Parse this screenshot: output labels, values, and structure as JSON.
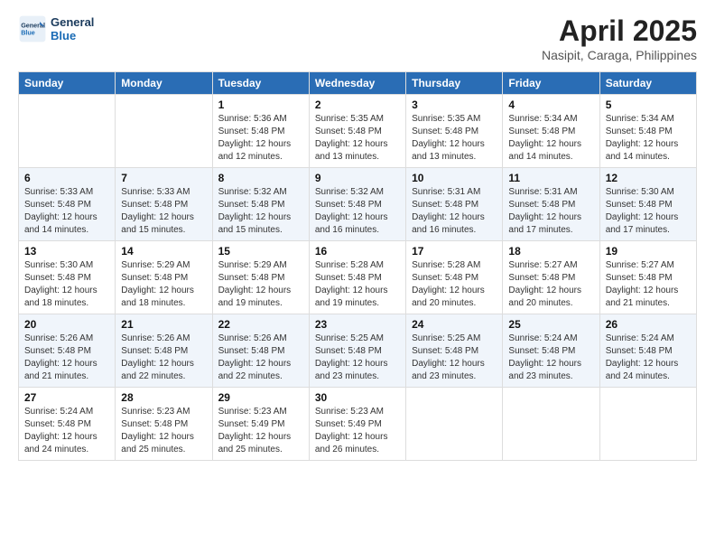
{
  "header": {
    "logo_line1": "General",
    "logo_line2": "Blue",
    "month_title": "April 2025",
    "location": "Nasipit, Caraga, Philippines"
  },
  "weekdays": [
    "Sunday",
    "Monday",
    "Tuesday",
    "Wednesday",
    "Thursday",
    "Friday",
    "Saturday"
  ],
  "weeks": [
    [
      {
        "day": "",
        "info": ""
      },
      {
        "day": "",
        "info": ""
      },
      {
        "day": "1",
        "info": "Sunrise: 5:36 AM\nSunset: 5:48 PM\nDaylight: 12 hours\nand 12 minutes."
      },
      {
        "day": "2",
        "info": "Sunrise: 5:35 AM\nSunset: 5:48 PM\nDaylight: 12 hours\nand 13 minutes."
      },
      {
        "day": "3",
        "info": "Sunrise: 5:35 AM\nSunset: 5:48 PM\nDaylight: 12 hours\nand 13 minutes."
      },
      {
        "day": "4",
        "info": "Sunrise: 5:34 AM\nSunset: 5:48 PM\nDaylight: 12 hours\nand 14 minutes."
      },
      {
        "day": "5",
        "info": "Sunrise: 5:34 AM\nSunset: 5:48 PM\nDaylight: 12 hours\nand 14 minutes."
      }
    ],
    [
      {
        "day": "6",
        "info": "Sunrise: 5:33 AM\nSunset: 5:48 PM\nDaylight: 12 hours\nand 14 minutes."
      },
      {
        "day": "7",
        "info": "Sunrise: 5:33 AM\nSunset: 5:48 PM\nDaylight: 12 hours\nand 15 minutes."
      },
      {
        "day": "8",
        "info": "Sunrise: 5:32 AM\nSunset: 5:48 PM\nDaylight: 12 hours\nand 15 minutes."
      },
      {
        "day": "9",
        "info": "Sunrise: 5:32 AM\nSunset: 5:48 PM\nDaylight: 12 hours\nand 16 minutes."
      },
      {
        "day": "10",
        "info": "Sunrise: 5:31 AM\nSunset: 5:48 PM\nDaylight: 12 hours\nand 16 minutes."
      },
      {
        "day": "11",
        "info": "Sunrise: 5:31 AM\nSunset: 5:48 PM\nDaylight: 12 hours\nand 17 minutes."
      },
      {
        "day": "12",
        "info": "Sunrise: 5:30 AM\nSunset: 5:48 PM\nDaylight: 12 hours\nand 17 minutes."
      }
    ],
    [
      {
        "day": "13",
        "info": "Sunrise: 5:30 AM\nSunset: 5:48 PM\nDaylight: 12 hours\nand 18 minutes."
      },
      {
        "day": "14",
        "info": "Sunrise: 5:29 AM\nSunset: 5:48 PM\nDaylight: 12 hours\nand 18 minutes."
      },
      {
        "day": "15",
        "info": "Sunrise: 5:29 AM\nSunset: 5:48 PM\nDaylight: 12 hours\nand 19 minutes."
      },
      {
        "day": "16",
        "info": "Sunrise: 5:28 AM\nSunset: 5:48 PM\nDaylight: 12 hours\nand 19 minutes."
      },
      {
        "day": "17",
        "info": "Sunrise: 5:28 AM\nSunset: 5:48 PM\nDaylight: 12 hours\nand 20 minutes."
      },
      {
        "day": "18",
        "info": "Sunrise: 5:27 AM\nSunset: 5:48 PM\nDaylight: 12 hours\nand 20 minutes."
      },
      {
        "day": "19",
        "info": "Sunrise: 5:27 AM\nSunset: 5:48 PM\nDaylight: 12 hours\nand 21 minutes."
      }
    ],
    [
      {
        "day": "20",
        "info": "Sunrise: 5:26 AM\nSunset: 5:48 PM\nDaylight: 12 hours\nand 21 minutes."
      },
      {
        "day": "21",
        "info": "Sunrise: 5:26 AM\nSunset: 5:48 PM\nDaylight: 12 hours\nand 22 minutes."
      },
      {
        "day": "22",
        "info": "Sunrise: 5:26 AM\nSunset: 5:48 PM\nDaylight: 12 hours\nand 22 minutes."
      },
      {
        "day": "23",
        "info": "Sunrise: 5:25 AM\nSunset: 5:48 PM\nDaylight: 12 hours\nand 23 minutes."
      },
      {
        "day": "24",
        "info": "Sunrise: 5:25 AM\nSunset: 5:48 PM\nDaylight: 12 hours\nand 23 minutes."
      },
      {
        "day": "25",
        "info": "Sunrise: 5:24 AM\nSunset: 5:48 PM\nDaylight: 12 hours\nand 23 minutes."
      },
      {
        "day": "26",
        "info": "Sunrise: 5:24 AM\nSunset: 5:48 PM\nDaylight: 12 hours\nand 24 minutes."
      }
    ],
    [
      {
        "day": "27",
        "info": "Sunrise: 5:24 AM\nSunset: 5:48 PM\nDaylight: 12 hours\nand 24 minutes."
      },
      {
        "day": "28",
        "info": "Sunrise: 5:23 AM\nSunset: 5:48 PM\nDaylight: 12 hours\nand 25 minutes."
      },
      {
        "day": "29",
        "info": "Sunrise: 5:23 AM\nSunset: 5:49 PM\nDaylight: 12 hours\nand 25 minutes."
      },
      {
        "day": "30",
        "info": "Sunrise: 5:23 AM\nSunset: 5:49 PM\nDaylight: 12 hours\nand 26 minutes."
      },
      {
        "day": "",
        "info": ""
      },
      {
        "day": "",
        "info": ""
      },
      {
        "day": "",
        "info": ""
      }
    ]
  ]
}
